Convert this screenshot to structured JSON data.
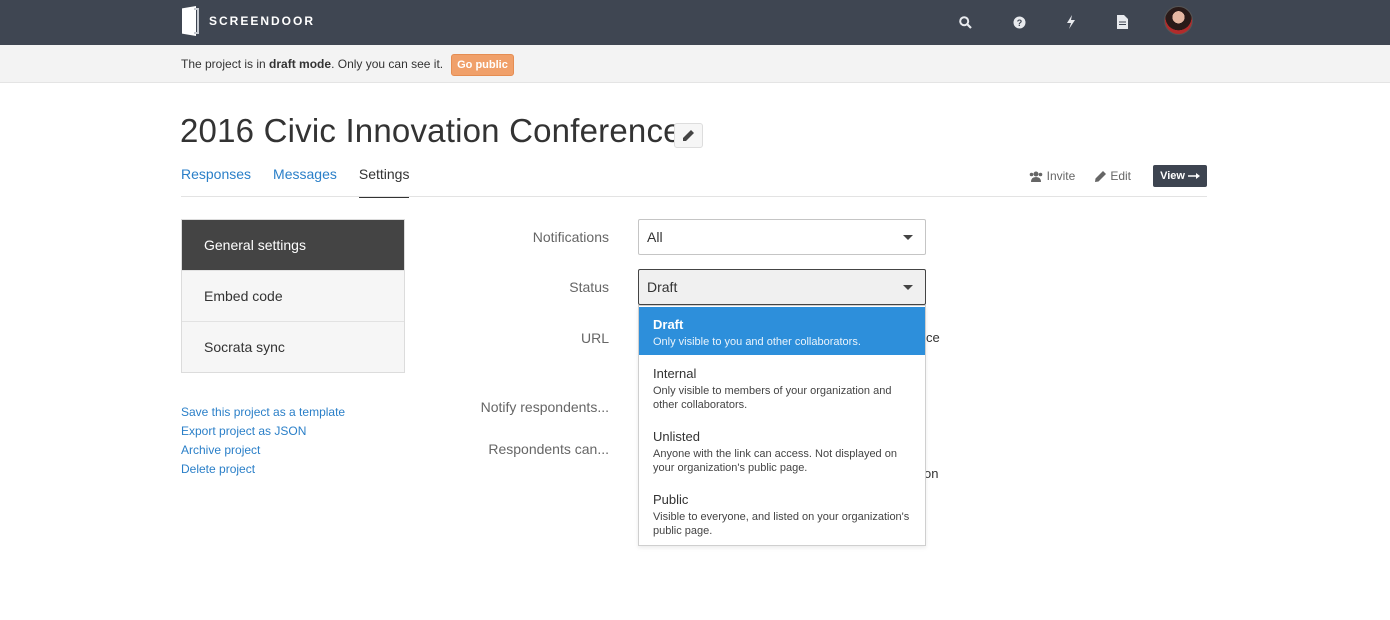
{
  "app": {
    "brand": "SCREENDOOR"
  },
  "topbar": {
    "icons": [
      "search-icon",
      "help-icon",
      "bolt-icon",
      "document-icon"
    ]
  },
  "banner": {
    "text_before": "The project is in ",
    "text_bold": "draft mode",
    "text_after": ". Only you can see it.",
    "button_label": "Go public"
  },
  "project": {
    "title": "2016 Civic Innovation Conference"
  },
  "tabs": [
    {
      "label": "Responses",
      "active": false
    },
    {
      "label": "Messages",
      "active": false
    },
    {
      "label": "Settings",
      "active": true
    }
  ],
  "header_actions": {
    "invite": "Invite",
    "edit": "Edit",
    "view": "View"
  },
  "sidebar": {
    "items": [
      {
        "label": "General settings",
        "active": true
      },
      {
        "label": "Embed code",
        "active": false
      },
      {
        "label": "Socrata sync",
        "active": false
      }
    ],
    "links": [
      "Save this project as a template",
      "Export project as JSON",
      "Archive project",
      "Delete project"
    ]
  },
  "form": {
    "notifications": {
      "label": "Notifications",
      "value": "All"
    },
    "status": {
      "label": "Status",
      "value": "Draft"
    },
    "url": {
      "label": "URL",
      "peek": "ce"
    },
    "notify": {
      "label": "Notify respondents..."
    },
    "respondents": {
      "label": "Respondents can...",
      "peek": "on"
    }
  },
  "status_options": [
    {
      "title": "Draft",
      "desc": "Only visible to you and other collaborators.",
      "selected": true
    },
    {
      "title": "Internal",
      "desc": "Only visible to members of your organization and other collaborators.",
      "selected": false
    },
    {
      "title": "Unlisted",
      "desc": "Anyone with the link can access. Not displayed on your organization's public page.",
      "selected": false
    },
    {
      "title": "Public",
      "desc": "Visible to everyone, and listed on your organization's public page.",
      "selected": false
    }
  ],
  "colors": {
    "topbar": "#3f4652",
    "link": "#2a7fc8",
    "accent_orange": "#f0a06a",
    "selected": "#2d8fdb"
  }
}
